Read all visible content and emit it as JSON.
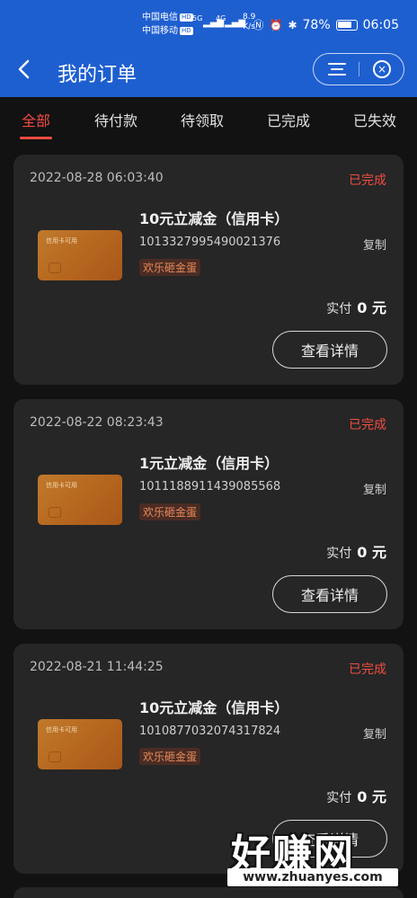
{
  "status_bar": {
    "carrier1": "中国电信",
    "carrier2": "中国移动",
    "hd": "HD",
    "network1": "5G",
    "network2": "4G",
    "speed_value": "8.9",
    "speed_unit": "K/s",
    "battery": "78%",
    "time": "06:05"
  },
  "header": {
    "title": "我的订单",
    "back_icon": "chevron-left-icon",
    "menu_icon": "menu-icon",
    "close_icon": "close-circle-icon"
  },
  "tabs": [
    {
      "label": "全部",
      "active": true
    },
    {
      "label": "待付款",
      "active": false
    },
    {
      "label": "待领取",
      "active": false
    },
    {
      "label": "已完成",
      "active": false
    },
    {
      "label": "已失效",
      "active": false
    }
  ],
  "orders": [
    {
      "time": "2022-08-28 06:03:40",
      "status": "已完成",
      "thumb_label": "信用卡可用",
      "product": "10元立减金（信用卡）",
      "code": "1013327995490021376",
      "copy": "复制",
      "tag": "欢乐砸金蛋",
      "paid_label": "实付",
      "paid_amount": "0 元",
      "button": "查看详情"
    },
    {
      "time": "2022-08-22 08:23:43",
      "status": "已完成",
      "thumb_label": "信用卡可用",
      "product": "1元立减金（信用卡）",
      "code": "1011188911439085568",
      "copy": "复制",
      "tag": "欢乐砸金蛋",
      "paid_label": "实付",
      "paid_amount": "0 元",
      "button": "查看详情"
    },
    {
      "time": "2022-08-21 11:44:25",
      "status": "已完成",
      "thumb_label": "信用卡可用",
      "product": "10元立减金（信用卡）",
      "code": "1010877032074317824",
      "copy": "复制",
      "tag": "欢乐砸金蛋",
      "paid_label": "实付",
      "paid_amount": "0 元",
      "button": "查看详情"
    }
  ],
  "watermark": {
    "text": "好赚网",
    "url": "www.zhuanyes.com"
  },
  "colors": {
    "header_bg": "#1e5fd0",
    "accent_red": "#f04c42",
    "page_bg": "#121212",
    "card_bg": "#262626"
  }
}
